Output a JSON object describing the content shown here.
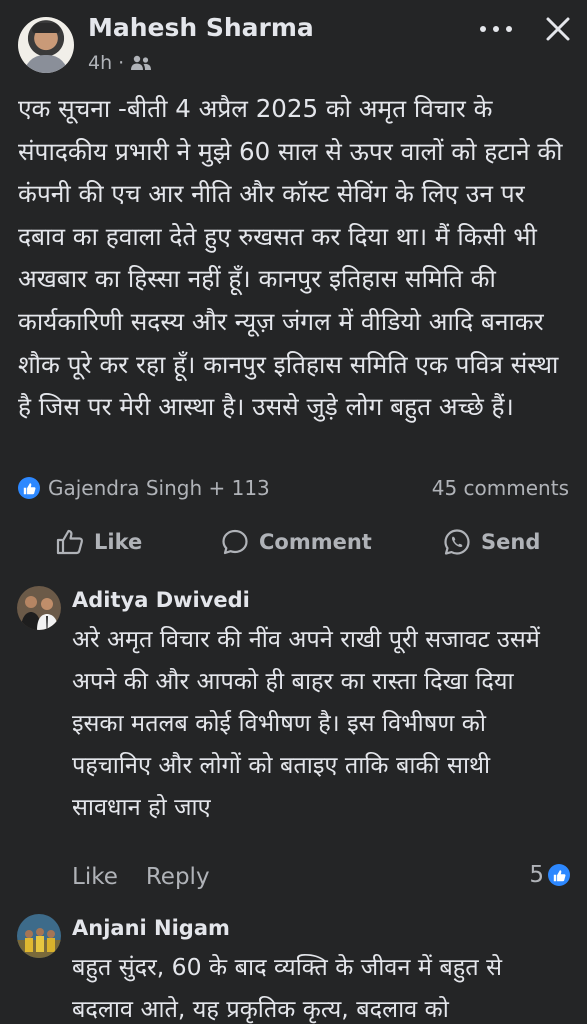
{
  "post": {
    "author": "Mahesh Sharma",
    "time": "4h ·",
    "audience_icon": "friends-icon",
    "text": "एक सूचना -बीती 4 अप्रैल 2025 को अमृत विचार के संपादकीय प्रभारी ने मुझे 60 साल से ऊपर वालों को हटाने की कंपनी की एच आर नीति  और कॉस्ट सेविंग के लिए उन पर दबाव का हवाला देते हुए रुखसत कर दिया था। मैं किसी भी अखबार का  हिस्सा नहीं हूँ। कानपुर इतिहास समिति की कार्यकारिणी सदस्य और न्यूज़ जंगल में वीडियो आदि बनाकर शौक पूरे कर रहा हूँ। कानपुर इतिहास समिति एक पवित्र संस्था है जिस पर मेरी आस्था है। उससे जुड़े लोग बहुत अच्छे हैं।",
    "reactions_text": "Gajendra Singh + 113",
    "comments_count": "45 comments"
  },
  "actions": {
    "like": "Like",
    "comment": "Comment",
    "send": "Send"
  },
  "comments": [
    {
      "name": "Aditya Dwivedi",
      "text": "अरे अमृत विचार की नींव अपने राखी पूरी सजावट उसमें अपने की और आपको ही बाहर का रास्ता दिखा दिया इसका मतलब कोई विभीषण है। इस विभीषण को पहचानिए और लोगों को बताइए ताकि बाकी साथी सावधान हो जाए",
      "like_label": "Like",
      "reply_label": "Reply",
      "like_count": "5"
    },
    {
      "name": "Anjani Nigam",
      "text": "बहुत सुंदर, 60 के बाद व्यक्ति के जीवन में बहुत से बदलाव आते, यह प्रकृतिक कृत्य, बदलाव को"
    }
  ],
  "colors": {
    "background": "#242526",
    "text": "#e4e6eb",
    "secondary": "#b0b3b8",
    "accent": "#2d88ff"
  }
}
